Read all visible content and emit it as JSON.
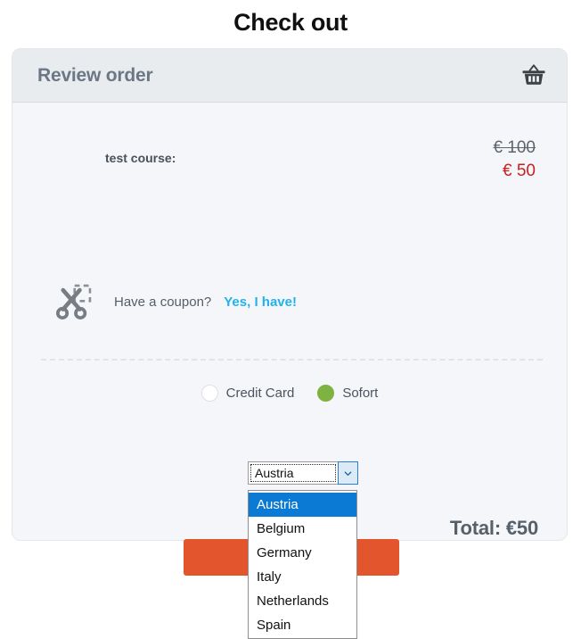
{
  "page": {
    "title": "Check out"
  },
  "card": {
    "header": {
      "title": "Review order",
      "icon": "shopping-basket-icon"
    },
    "line_item": {
      "name": "test course:",
      "price_original": "€ 100",
      "price_discounted": "€ 50"
    },
    "coupon": {
      "icon": "scissors-icon",
      "question": "Have a coupon?",
      "link_label": "Yes, I have!"
    },
    "payment_methods": [
      {
        "label": "Credit Card",
        "selected": false
      },
      {
        "label": "Sofort",
        "selected": true
      }
    ],
    "country_select": {
      "value": "Austria",
      "expanded": true,
      "arrow_icon": "chevron-down-icon",
      "options": [
        "Austria",
        "Belgium",
        "Germany",
        "Italy",
        "Netherlands",
        "Spain"
      ],
      "highlighted_option": "Austria"
    },
    "total_label": "Total: €50",
    "pay_button_label": ""
  },
  "colors": {
    "accent_orange": "#e2552d",
    "link_cyan": "#22b2ea",
    "price_red": "#cc1f1f",
    "radio_green": "#7fb341",
    "dropdown_highlight": "#0b7ad4",
    "card_background": "#f4f6fa",
    "card_header_background": "#e9ecef"
  }
}
